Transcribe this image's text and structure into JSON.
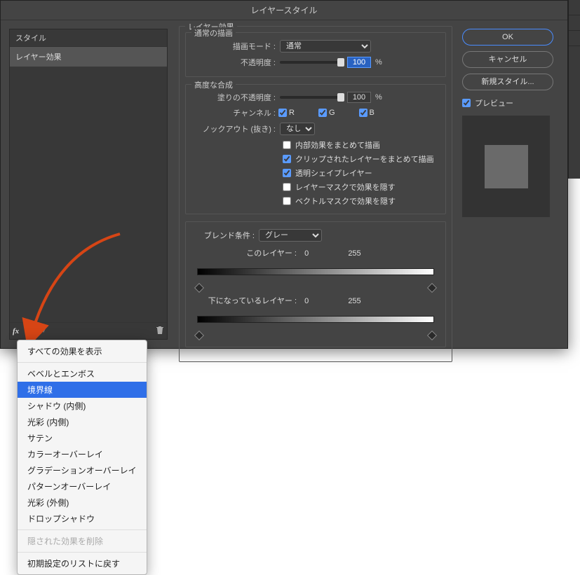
{
  "title": "レイヤースタイル",
  "left": {
    "header": "スタイル",
    "selected_item": "レイヤー効果"
  },
  "effects": {
    "group_label": "レイヤー効果",
    "normal_group": "通常の描画",
    "blend_mode_label": "描画モード :",
    "blend_mode_value": "通常",
    "opacity_label": "不透明度 :",
    "opacity_value": "100",
    "opacity_unit": "%",
    "advanced_group": "高度な合成",
    "fill_opacity_label": "塗りの不透明度 :",
    "fill_opacity_value": "100",
    "fill_opacity_unit": "%",
    "channel_label": "チャンネル :",
    "ch_r": "R",
    "ch_g": "G",
    "ch_b": "B",
    "knockout_label": "ノックアウト (抜き) :",
    "knockout_value": "なし",
    "cb1": "内部効果をまとめて描画",
    "cb2": "クリップされたレイヤーをまとめて描画",
    "cb3": "透明シェイプレイヤー",
    "cb4": "レイヤーマスクで効果を隠す",
    "cb5": "ベクトルマスクで効果を隠す",
    "blendif_label": "ブレンド条件 :",
    "blendif_value": "グレー",
    "this_layer_label": "このレイヤー :",
    "this_low": "0",
    "this_high": "255",
    "under_layer_label": "下になっているレイヤー :",
    "under_low": "0",
    "under_high": "255"
  },
  "right": {
    "ok": "OK",
    "cancel": "キャンセル",
    "new_style": "新規スタイル...",
    "preview": "プレビュー"
  },
  "popup": {
    "items": [
      "すべての効果を表示",
      "ベベルとエンボス",
      "境界線",
      "シャドウ (内側)",
      "光彩 (内側)",
      "サテン",
      "カラーオーバーレイ",
      "グラデーションオーバーレイ",
      "パターンオーバーレイ",
      "光彩 (外側)",
      "ドロップシャドウ"
    ],
    "disabled": "隠された効果を削除",
    "reset": "初期設定のリストに戻す"
  }
}
